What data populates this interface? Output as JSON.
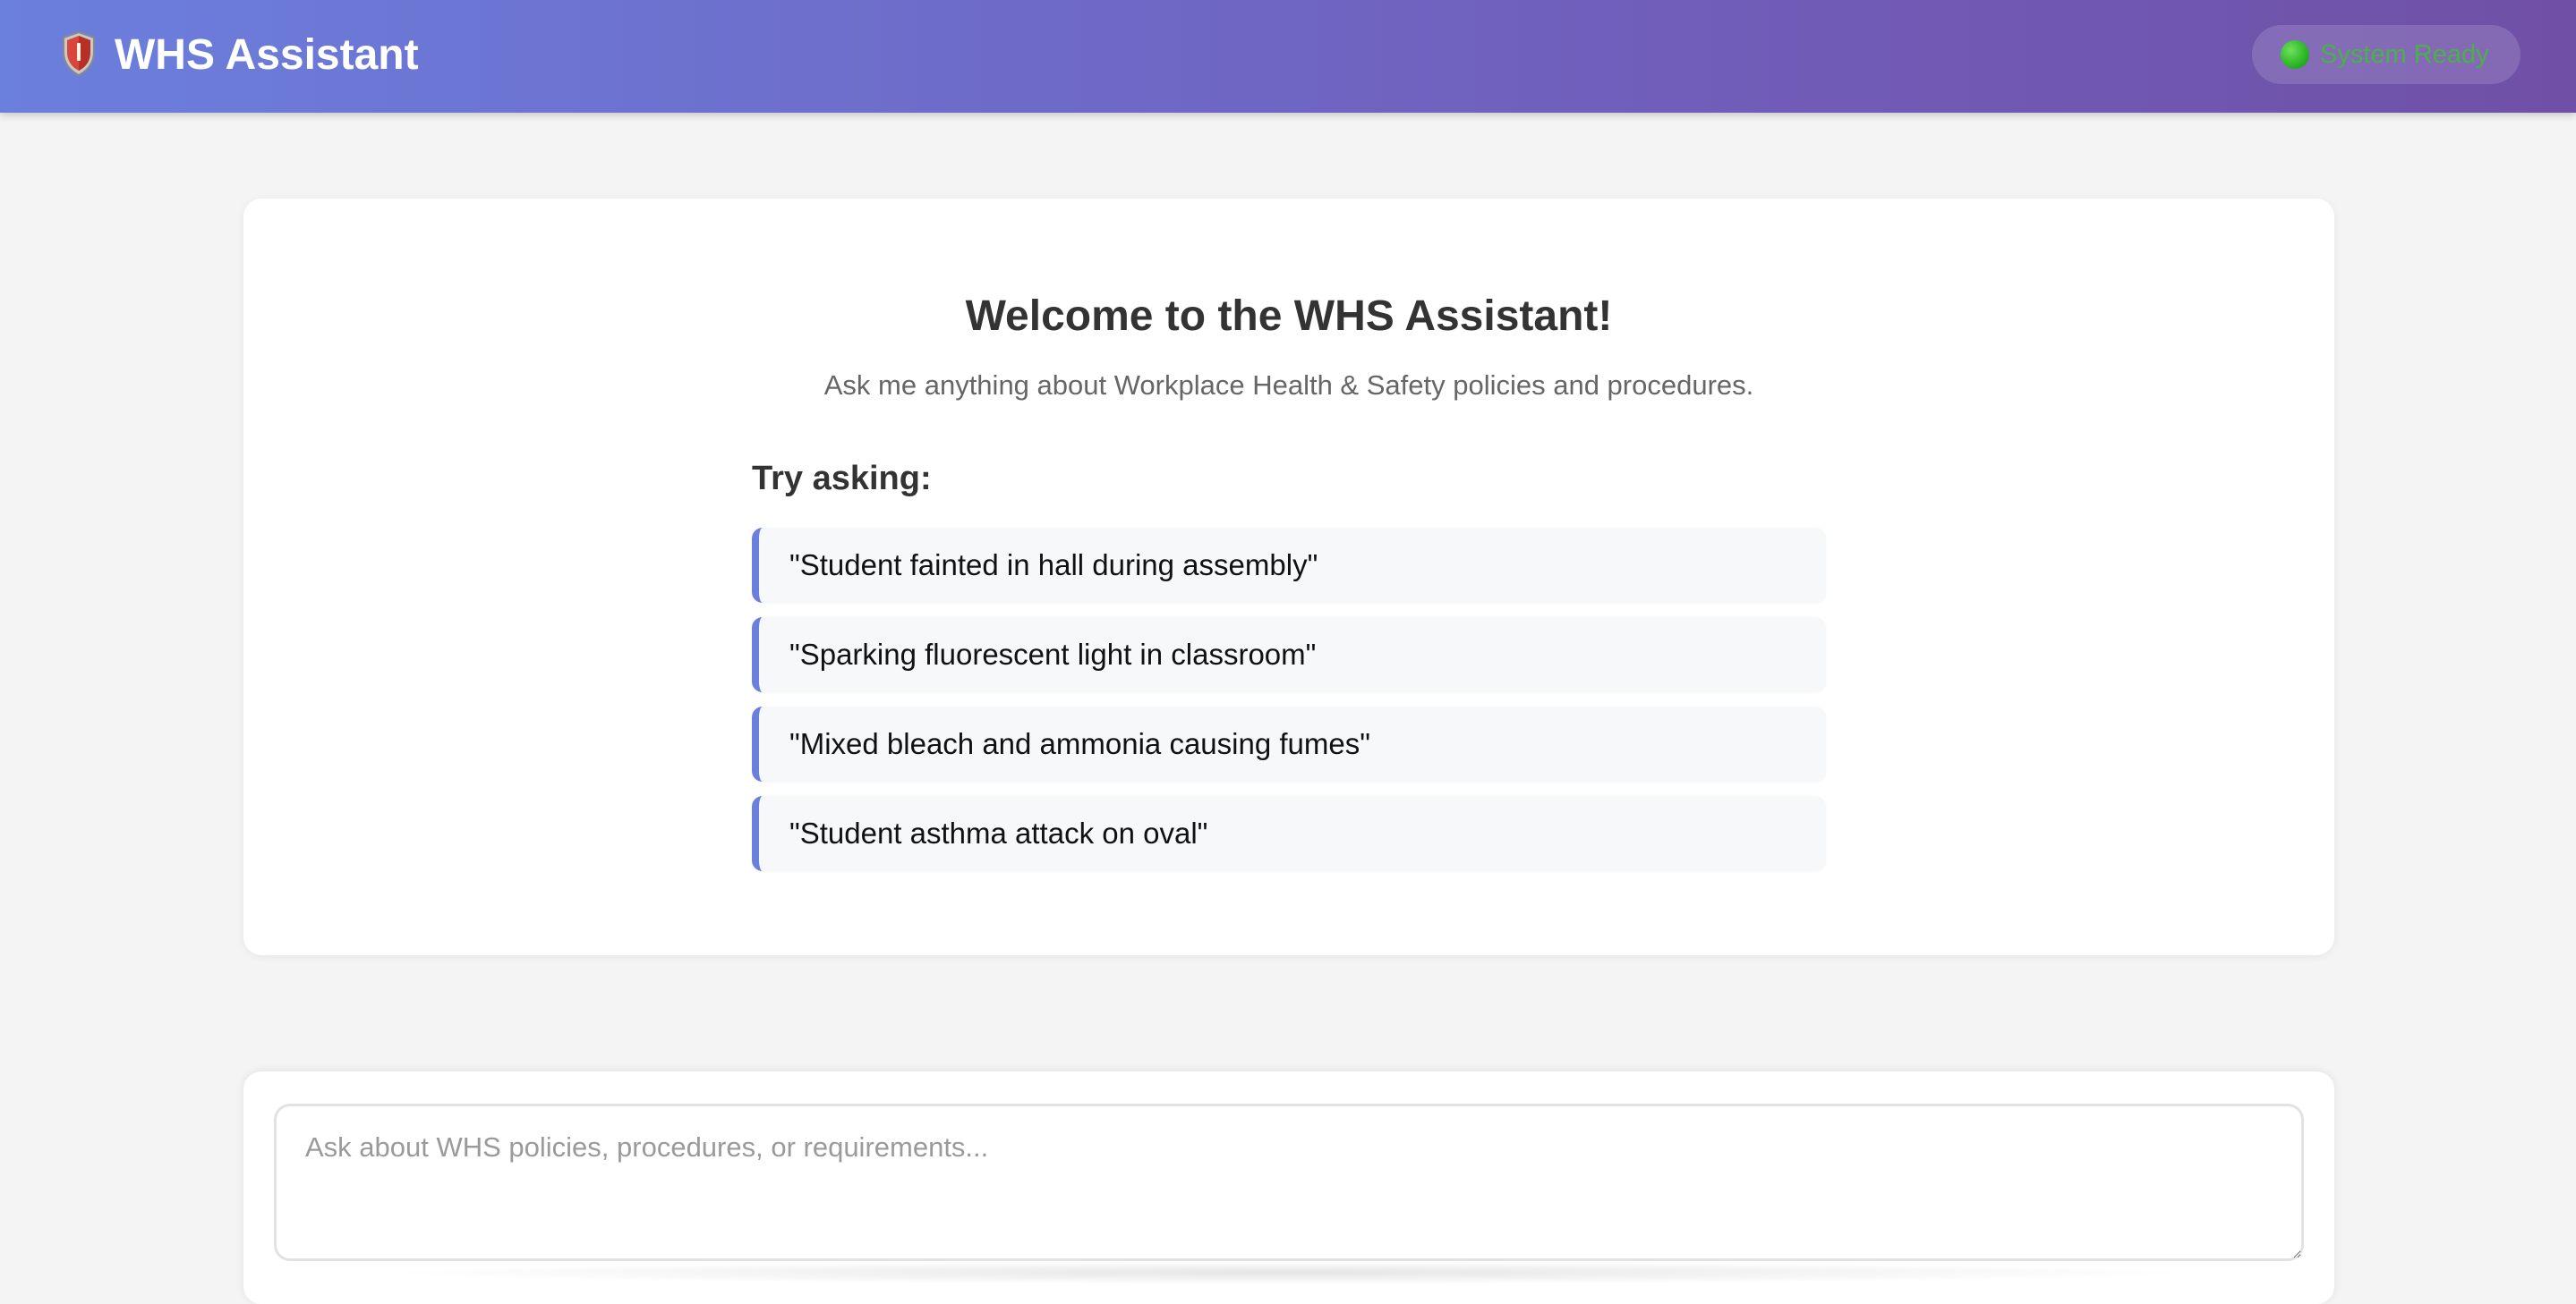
{
  "header": {
    "title": "WHS Assistant",
    "logo_icon": "shield-icon",
    "status": {
      "label": "System Ready",
      "indicator_icon": "green-circle-icon",
      "color": "#4bb04b"
    },
    "gradient_start": "#6b7fdd",
    "gradient_end": "#7050a6"
  },
  "welcome": {
    "title": "Welcome to the WHS Assistant!",
    "subtitle": "Ask me anything about Workplace Health & Safety policies and procedures.",
    "try_heading": "Try asking:",
    "suggestions": [
      "\"Student fainted in hall during assembly\"",
      "\"Sparking fluorescent light in classroom\"",
      "\"Mixed bleach and ammonia causing fumes\"",
      "\"Student asthma attack on oval\""
    ],
    "accent_color": "#6b7fdd"
  },
  "input": {
    "value": "",
    "placeholder": "Ask about WHS policies, procedures, or requirements..."
  }
}
